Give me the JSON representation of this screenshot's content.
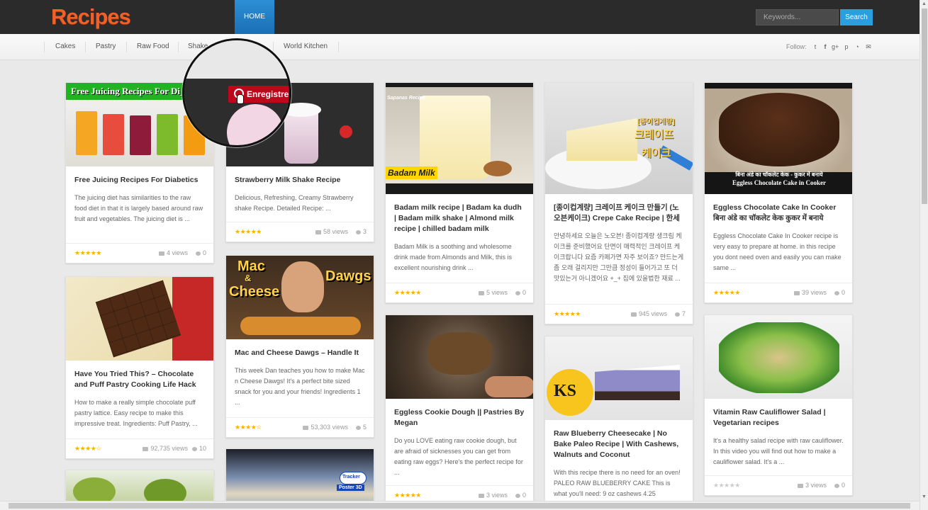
{
  "header": {
    "logo": "Recipes",
    "home_tab": "HOME",
    "search_placeholder": "Keywords...",
    "search_button": "Search"
  },
  "subnav": {
    "items": [
      "Cakes",
      "Pastry",
      "Raw Food",
      "Shake",
      "World Kitchen"
    ],
    "follow_label": "Follow:",
    "social_icons": [
      "twitter-icon",
      "facebook-icon",
      "google-plus-icon",
      "pinterest-icon",
      "rss-icon",
      "email-icon"
    ]
  },
  "pin_button": "Enregistrer",
  "colors": {
    "accent": "#2a9fe0",
    "logo": "#f0612a",
    "star": "#f5b301",
    "pin": "#bd081c"
  },
  "cards": [
    {
      "title": "Free Juicing Recipes For Diabetics",
      "excerpt": "The juicing diet has similarities to the raw food diet in that it is largely based around raw fruit and vegetables. The juicing diet is ...",
      "views": "4 views",
      "comments": "0",
      "rating": 5,
      "thumb_text": "Free Juicing Recipes For Di_cS"
    },
    {
      "title": "Strawberry Milk Shake Recipe",
      "excerpt": "Delicious, Refreshing, Creamy Strawberry shake Recipe. Detailed Recipe: ...",
      "views": "58 views",
      "comments": "3",
      "rating": 5
    },
    {
      "title": "Badam milk recipe | Badam ka dudh | Badam milk shake | Almond milk recipe | chilled badam milk",
      "excerpt": "Badam Milk is a soothing and wholesome drink made from Almonds and Milk, this is excellent nourishing drink ...",
      "views": "5 views",
      "comments": "0",
      "rating": 5,
      "thumb_text": "Badam Milk",
      "thumb_small": "Sapanas Recipe"
    },
    {
      "title": "[종이컵계량] 크레이프 케이크 만들기 (노오븐케이크) Crepe Cake Recipe | 한세",
      "excerpt": "안녕하세요 오늘은 노오븐! 종이컵계량 생크림 케이크를 준비했어요 단면이 매력적인 크레이프 케이크랍니다 요즘 카페가면 자주 보이죠? 만드는게 좀 오래 걸리지만 그만큼 정성이 들어가고 또 더 맛있는거 아니겠어요 +_+ 집에 있을법한 재료 ...",
      "views": "945 views",
      "comments": "7",
      "rating": 5,
      "thumb_text": "[종이컵계량]",
      "thumb_text2": "크레이프",
      "thumb_text3": "케이크"
    },
    {
      "title": "Eggless Chocolate Cake In Cooker बिना अंडे का चॉकलेट केक कुकर में बनाये",
      "excerpt": "Eggless Chocolate Cake In Cooker recipe is very easy to prepare at home. in this recipe you dont need oven and easily you can make same ...",
      "views": "39 views",
      "comments": "0",
      "rating": 5,
      "thumb_text": "बिना अंडे का चॉकलेट केक - कुकर में बनाये",
      "thumb_text2": "Eggless Chocolate Cake in Cooker"
    },
    {
      "title": "Have You Tried This? – Chocolate and Puff Pastry Cooking Life Hack",
      "excerpt": "How to make a really simple chocolate puff pastry lattice. Easy recipe to make this impressive treat. Ingredients: Puff Pastry, ...",
      "views": "92,735 views",
      "comments": "10",
      "rating": 4.5
    },
    {
      "title": "Mac and Cheese Dawgs – Handle It",
      "excerpt": "This week Dan teaches you how to make Mac n Cheese Dawgs! It's a perfect bite sized snack for you and your friends! Ingredients 1 ...",
      "views": "53,303 views",
      "comments": "5",
      "rating": 4.5,
      "thumb_text": "Mac",
      "thumb_text2": "&",
      "thumb_text3": "Cheese",
      "thumb_text4": "Dawgs"
    },
    {
      "title": "Eggless Cookie Dough || Pastries By Megan",
      "excerpt": "Do you LOVE eating raw cookie dough, but are afraid of sicknesses you can get from eating raw eggs? Here's the perfect recipe for ...",
      "views": "3 views",
      "comments": "0",
      "rating": 5
    },
    {
      "title": "Raw Blueberry Cheesecake | No Bake Paleo Recipe | With Cashews, Walnuts and Coconut",
      "excerpt": "With this recipe there is no need for an oven! PALEO RAW BLUEBERRY CAKE This is what you'll need: 9 oz cashews 4.25",
      "views": "",
      "comments": "",
      "rating": 5,
      "thumb_text": "KS"
    },
    {
      "title": "Vitamin Raw Cauliflower Salad | Vegetarian recipes",
      "excerpt": "It's a healthy salad recipe with raw cauliflower. In this video you will find out how to make a cauliflower salad. It's a ...",
      "views": "3 views",
      "comments": "0",
      "rating": 0
    },
    {
      "title": "",
      "excerpt": "",
      "views": "",
      "comments": "",
      "rating": 0
    },
    {
      "title": "",
      "excerpt": "",
      "views": "",
      "comments": "",
      "rating": 0,
      "thumb_text": "Tracker",
      "thumb_text2": "Poster 3D"
    }
  ]
}
